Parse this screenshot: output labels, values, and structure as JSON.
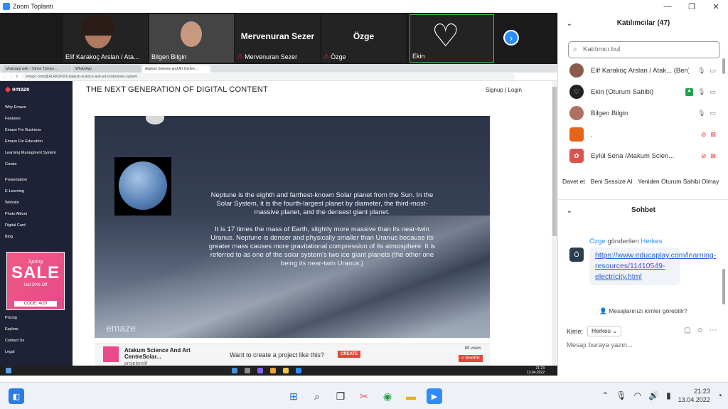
{
  "window": {
    "title": "Zoom Toplantı"
  },
  "video_strip": {
    "tiles": [
      {
        "name": "Elif Karakoç Arslan / Ata...",
        "muted": false
      },
      {
        "name": "Bilgen Bilgin",
        "muted": false
      },
      {
        "name": "Mervenuran Sezer",
        "big": "Mervenuran Sezer",
        "muted": true
      },
      {
        "name": "Özge",
        "big": "Özge",
        "muted": true
      },
      {
        "name": "Ekin",
        "muted": false
      }
    ]
  },
  "browser": {
    "tabs": [
      "whatsapp web - Yahoo Türkiye...",
      "WhatsApp",
      "Atakum Science and Art Centre..."
    ],
    "url": "emaze.com/@ALRKZFW1/atakum-science-and-art-centresolar-system"
  },
  "emaze": {
    "logo": "emaze",
    "nav_top": [
      "Why Emaze",
      "Features",
      "Emaze For Business",
      "Emaze For Education",
      "Learning Managment System",
      "Create"
    ],
    "nav_mid": [
      "Presentation",
      "E-Learning",
      "Website",
      "Photo Album",
      "Digital Card",
      "Blog"
    ],
    "nav_bottom": [
      "Pricing",
      "Explore",
      "Contact Us",
      "Legal"
    ],
    "promo": {
      "season": "Spring",
      "sale": "SALE",
      "discount": "Get 20% Off",
      "code": "CODE: 4/20"
    },
    "heading": "THE NEXT GENERATION OF DIGITAL CONTENT",
    "signup": "Signup",
    "separator": "|",
    "login": "Login",
    "slide": {
      "para1": "Neptune is the eighth and farthest-known Solar planet from the Sun. In the Solar System, it is the fourth-largest planet by diameter, the third-most-massive planet, and the densest giant planet.",
      "para2": "It is 17 times the mass of Earth, slightly more massive than its near-twin Uranus. Neptune is denser and physically smaller than Uranus because its greater mass causes more gravitational compression of its atmosphere. It is referred to as one of the solar system's two ice giant planets (the other one being its near-twin Uranus.)",
      "watermark": "emaze"
    },
    "footer": {
      "project_title": "Atakum Science And Art CentreSolar...",
      "author": "projelerelif",
      "want": "Want to create a project like this?",
      "create": "CREATE",
      "views": "88 views",
      "share": "< SHARE"
    }
  },
  "inner_taskbar": {
    "time": "21:23",
    "date": "13.04.2022"
  },
  "participants": {
    "header": "Katılımcılar (47)",
    "search_placeholder": "Katılımcı bul",
    "list": [
      {
        "name": "Elif Karakoç Arslan / Atak... (Ben)",
        "color": "#8a5a4a"
      },
      {
        "name": "Ekin (Oturum Sahibi)",
        "color": "#222222"
      },
      {
        "name": "Bilgen Bilgin",
        "color": "#b07060"
      },
      {
        "name": ".",
        "color": "#e8631a"
      },
      {
        "name": "Eylül Sena /Atakum Scien...",
        "color": "#d9534f"
      }
    ],
    "buttons": [
      "Davet et",
      "Beni Sessize Al",
      "Yeniden Oturum Sahibi Olmay"
    ]
  },
  "chat": {
    "header": "Sohbet",
    "sender": "Özge",
    "sent_label": "gönderilen",
    "recipient": "Herkes",
    "avatar": "Ö",
    "link": "https://www.educaplay.com/learning-resources/11410549-electricity.html",
    "who_can_see": "Mesajlarınızı kimler görebilir?",
    "to_label": "Kime:",
    "to_value": "Herkes",
    "input_placeholder": "Mesajı buraya yazın..."
  },
  "taskbar": {
    "time": "21:23",
    "date": "13.04.2022"
  }
}
